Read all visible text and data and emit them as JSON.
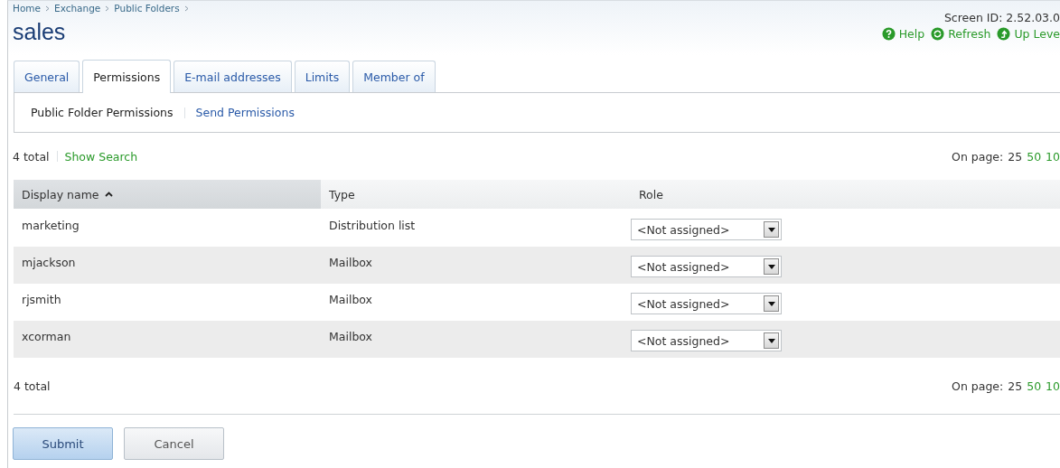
{
  "breadcrumb": [
    "Home",
    "Exchange",
    "Public Folders"
  ],
  "title": "sales",
  "screen_id": "Screen ID:  2.52.03.0",
  "header_links": [
    {
      "label": "Help",
      "kind": "help"
    },
    {
      "label": "Refresh",
      "kind": "refresh"
    },
    {
      "label": "Up Leve",
      "kind": "up"
    }
  ],
  "tabs": [
    {
      "label": "General",
      "selected": false
    },
    {
      "label": "Permissions",
      "selected": true
    },
    {
      "label": "E-mail addresses",
      "selected": false
    },
    {
      "label": "Limits",
      "selected": false
    },
    {
      "label": "Member of",
      "selected": false
    }
  ],
  "subtabs": [
    {
      "label": "Public Folder Permissions",
      "selected": true
    },
    {
      "label": "Send Permissions",
      "selected": false
    }
  ],
  "top_bar": {
    "total": "4 total",
    "show_search": "Show Search",
    "on_page_label": "On page:",
    "page_sizes": [
      {
        "label": "25",
        "selected": true
      },
      {
        "label": "50",
        "selected": false
      },
      {
        "label": "10",
        "selected": false
      }
    ]
  },
  "table": {
    "columns": [
      {
        "label": "Display name",
        "sorted": true
      },
      {
        "label": "Type",
        "sorted": false
      },
      {
        "label": "Role",
        "sorted": false
      }
    ],
    "rows": [
      {
        "name": "marketing",
        "type": "Distribution list",
        "role": "<Not assigned>"
      },
      {
        "name": "mjackson",
        "type": "Mailbox",
        "role": "<Not assigned>"
      },
      {
        "name": "rjsmith",
        "type": "Mailbox",
        "role": "<Not assigned>"
      },
      {
        "name": "xcorman",
        "type": "Mailbox",
        "role": "<Not assigned>"
      }
    ]
  },
  "bottom_bar": {
    "total": "4 total",
    "on_page_label": "On page:",
    "page_sizes": [
      {
        "label": "25",
        "selected": true
      },
      {
        "label": "50",
        "selected": false
      },
      {
        "label": "10",
        "selected": false
      }
    ]
  },
  "buttons": [
    {
      "label": "Submit",
      "kind": "primary"
    },
    {
      "label": "Cancel",
      "kind": "secondary"
    }
  ]
}
